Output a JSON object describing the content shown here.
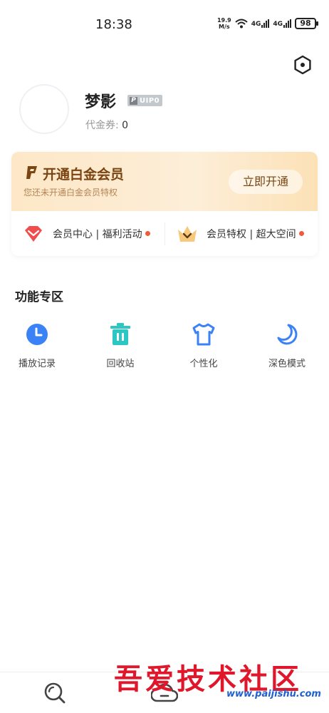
{
  "status_bar": {
    "time": "18:38",
    "net_speed_value": "19.9",
    "net_speed_unit": "M/s",
    "signal1": "4G",
    "signal2": "4G",
    "battery": "98"
  },
  "profile": {
    "username": "梦影",
    "vip_level": "UIP0",
    "voucher_label": "代金券:",
    "voucher_value": "0"
  },
  "vip_card": {
    "title": "开通白金会员",
    "subtitle": "您还未开通白金会员特权",
    "open_button": "立即开通",
    "member_center": "会员中心 | 福利活动",
    "member_privileges": "会员特权 | 超大空间"
  },
  "functions": {
    "title": "功能专区",
    "items": [
      {
        "label": "播放记录",
        "icon": "clock-icon"
      },
      {
        "label": "回收站",
        "icon": "trash-icon"
      },
      {
        "label": "个性化",
        "icon": "tshirt-icon"
      },
      {
        "label": "深色模式",
        "icon": "moon-icon"
      }
    ]
  },
  "bottom_nav": {
    "items": [
      "search-icon",
      "cloud-icon"
    ]
  },
  "watermark": {
    "text": "吾爱技术社区",
    "url": "www.paijishu.com"
  },
  "colors": {
    "accent_blue": "#3b82f6",
    "teal": "#2cc7c3",
    "vip_brown": "#7a4512",
    "red_dot": "#ee5a3c"
  }
}
